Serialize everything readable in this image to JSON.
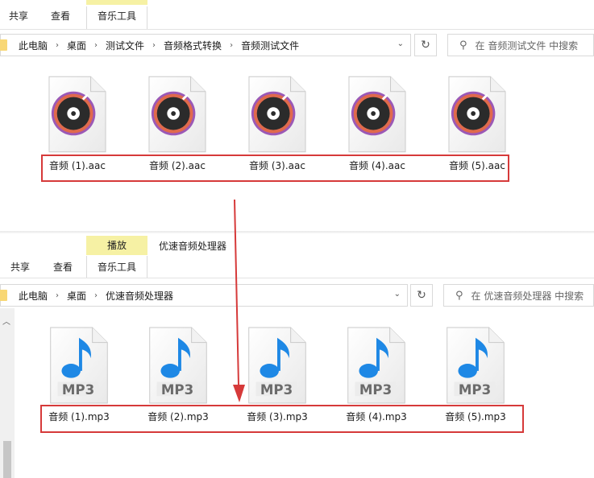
{
  "top_window": {
    "ribbon": {
      "context_header": "",
      "tabs": [
        "共享",
        "查看",
        "音乐工具"
      ]
    },
    "address": {
      "breadcrumbs": [
        "此电脑",
        "桌面",
        "测试文件",
        "音频格式转换",
        "音频测试文件"
      ]
    },
    "search": {
      "placeholder": "在 音频测试文件 中搜索"
    },
    "files": [
      {
        "name": "音频 (1).aac",
        "icon": "aac-disc-icon"
      },
      {
        "name": "音频 (2).aac",
        "icon": "aac-disc-icon"
      },
      {
        "name": "音频 (3).aac",
        "icon": "aac-disc-icon"
      },
      {
        "name": "音频 (4).aac",
        "icon": "aac-disc-icon"
      },
      {
        "name": "音频 (5).aac",
        "icon": "aac-disc-icon"
      }
    ]
  },
  "bottom_window": {
    "ribbon": {
      "context_header": "播放",
      "app_title": "优速音频处理器",
      "tabs": [
        "共享",
        "查看",
        "音乐工具"
      ]
    },
    "address": {
      "breadcrumbs": [
        "此电脑",
        "桌面",
        "优速音频处理器"
      ]
    },
    "search": {
      "placeholder": "在 优速音频处理器 中搜索"
    },
    "files": [
      {
        "name": "音频 (1).mp3",
        "icon": "mp3-note-icon",
        "badge": "MP3"
      },
      {
        "name": "音频 (2).mp3",
        "icon": "mp3-note-icon",
        "badge": "MP3"
      },
      {
        "name": "音频 (3).mp3",
        "icon": "mp3-note-icon",
        "badge": "MP3"
      },
      {
        "name": "音频 (4).mp3",
        "icon": "mp3-note-icon",
        "badge": "MP3"
      },
      {
        "name": "音频 (5).mp3",
        "icon": "mp3-note-icon",
        "badge": "MP3"
      }
    ]
  },
  "colors": {
    "highlight_box": "#d63a3a",
    "context_tab": "#f6f1a4",
    "note_blue": "#1e88e5"
  }
}
